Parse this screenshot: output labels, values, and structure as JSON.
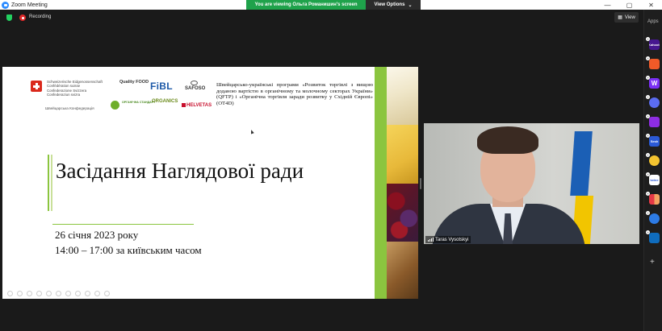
{
  "window": {
    "title": "Zoom Meeting",
    "controls": [
      "—",
      "▢",
      "✕"
    ]
  },
  "share_banner": {
    "message": "You are viewing Ольга Романишин's screen",
    "options_label": "View Options",
    "options_chevron": "⌄"
  },
  "meeting_bar": {
    "recording_label": "Recording",
    "view_label": "View",
    "security_icon": "shield-icon",
    "recording_icon": "record-icon"
  },
  "apps_sidebar": {
    "label": "Apps",
    "items": [
      {
        "name": "kahoot",
        "text": "Kahoot!",
        "color": "#46178f"
      },
      {
        "name": "app-orange",
        "text": "",
        "color": "#f05a28"
      },
      {
        "name": "app-w",
        "text": "W",
        "color": "#7b2ff7"
      },
      {
        "name": "app-globe",
        "text": "",
        "color": "#5b6cf0"
      },
      {
        "name": "app-video",
        "text": "",
        "color": "#8e2de2"
      },
      {
        "name": "app-sesh",
        "text": "Sesh",
        "color": "#2b5ad6"
      },
      {
        "name": "app-smile",
        "text": "",
        "color": "#f4c430"
      },
      {
        "name": "app-twine",
        "text": "twine",
        "color": "#ffffff"
      },
      {
        "name": "app-grid",
        "text": "",
        "color": "#f5f5f5"
      },
      {
        "name": "app-sync",
        "text": "",
        "color": "#2d7be5"
      },
      {
        "name": "app-outlook",
        "text": "",
        "color": "#0f6cbd"
      }
    ],
    "add_label": "+"
  },
  "slide": {
    "swiss_confederation": [
      "Schweizerische Eidgenossenschaft",
      "Confédération suisse",
      "Confederazione Svizzera",
      "Confederaziun svizra"
    ],
    "swiss_short": "Швейцарська Конфедерація",
    "logos": {
      "quality_food": "Quality FOOD",
      "fibl": "FiBL",
      "safoso": "SAFOSO",
      "organic_org": "ОРГАНІЧНА СТАНДАРТ",
      "organics": "ORGANICS",
      "helvetas": "HELVETAS"
    },
    "program_text": "Швейцарсько-українські програми «Розвиток торгівлі з вищою доданою вартістю в органічному та молочному секторах України» (QFTP) і «Органічна торгівля заради розвитку у Східній Європі» (OT4D)",
    "title": "Засідання Наглядової ради",
    "date": "26 січня 2023 року",
    "time": "14:00 – 17:00 за київським часом",
    "accent_color": "#8bc53f"
  },
  "video": {
    "participant_name": "Taras Vysotskyi"
  }
}
